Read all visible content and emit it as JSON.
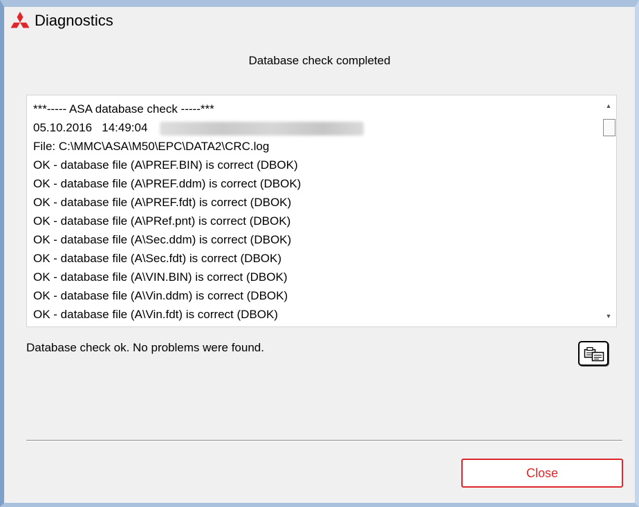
{
  "window": {
    "title": "Diagnostics",
    "logo_icon": "mitsubishi-logo-icon",
    "accent_color": "#e0262a"
  },
  "heading": "Database check completed",
  "log": {
    "lines": [
      "***----- ASA database check -----***",
      "05.10.2016   14:49:04",
      "File: C:\\MMC\\ASA\\M50\\EPC\\DATA2\\CRC.log",
      "OK - database file (A\\PREF.BIN) is correct (DBOK)",
      "OK - database file (A\\PREF.ddm) is correct (DBOK)",
      "OK - database file (A\\PREF.fdt) is correct (DBOK)",
      "OK - database file (A\\PRef.pnt) is correct (DBOK)",
      "OK - database file (A\\Sec.ddm) is correct (DBOK)",
      "OK - database file (A\\Sec.fdt) is correct (DBOK)",
      "OK - database file (A\\VIN.BIN) is correct (DBOK)",
      "OK - database file (A\\Vin.ddm) is correct (DBOK)",
      "OK - database file (A\\Vin.fdt) is correct (DBOK)"
    ]
  },
  "status_text": "Database check ok. No problems were found.",
  "copy_button_icon": "clipboard-copy-icon",
  "close_label": "Close"
}
